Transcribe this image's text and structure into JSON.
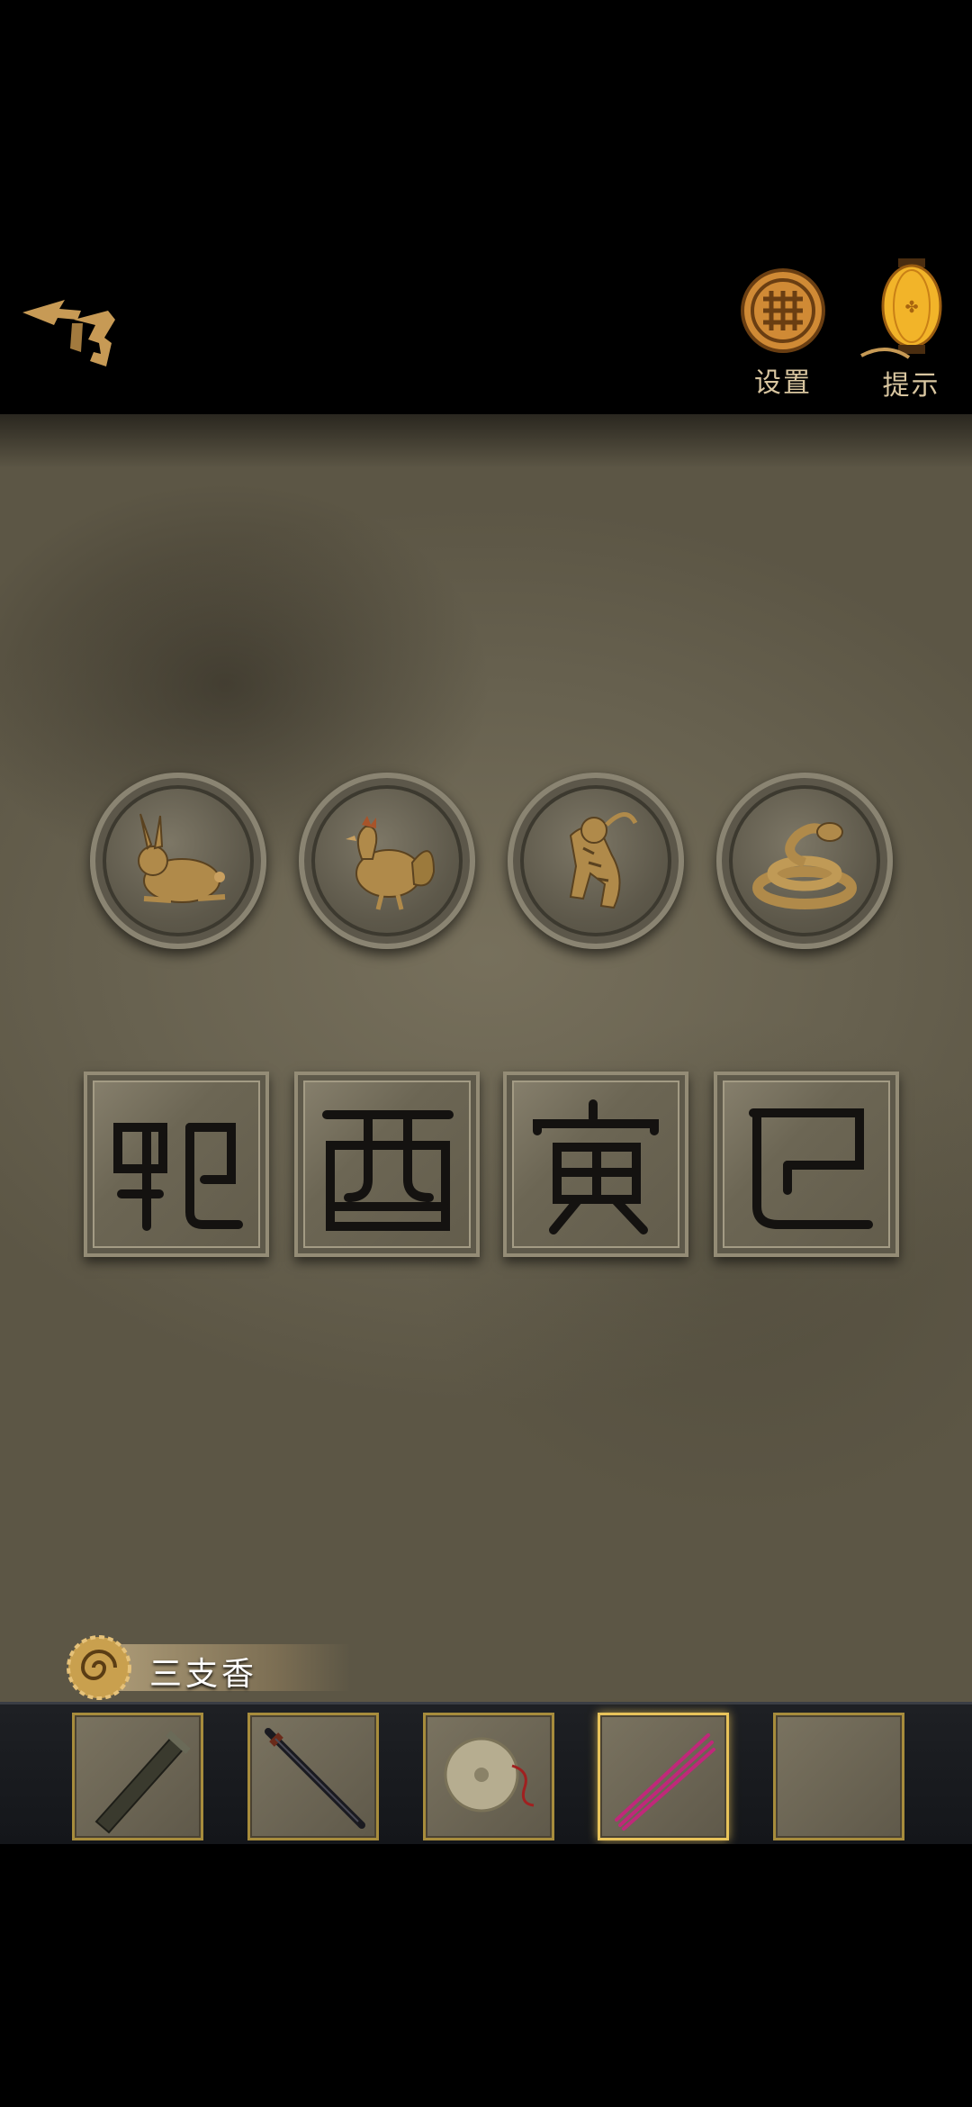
{
  "header": {
    "settings_label": "设置",
    "hint_label": "提示"
  },
  "puzzle": {
    "coins": [
      {
        "animal": "rabbit"
      },
      {
        "animal": "rooster"
      },
      {
        "animal": "tiger"
      },
      {
        "animal": "snake"
      }
    ],
    "tiles": [
      {
        "glyph": "卯"
      },
      {
        "glyph": "酉"
      },
      {
        "glyph": "寅"
      },
      {
        "glyph": "巳"
      }
    ]
  },
  "selected_item": {
    "name": "三支香"
  },
  "inventory": {
    "slots": [
      {
        "item": "scroll-tube",
        "selected": false
      },
      {
        "item": "sword",
        "selected": false
      },
      {
        "item": "bronze-mirror",
        "selected": false
      },
      {
        "item": "incense-sticks",
        "selected": true
      },
      {
        "item": "empty",
        "selected": false
      }
    ]
  },
  "colors": {
    "gold": "#c9933a",
    "board": "#6b6552",
    "slot_border": "#a78c3c",
    "incense": "#c0287a"
  }
}
